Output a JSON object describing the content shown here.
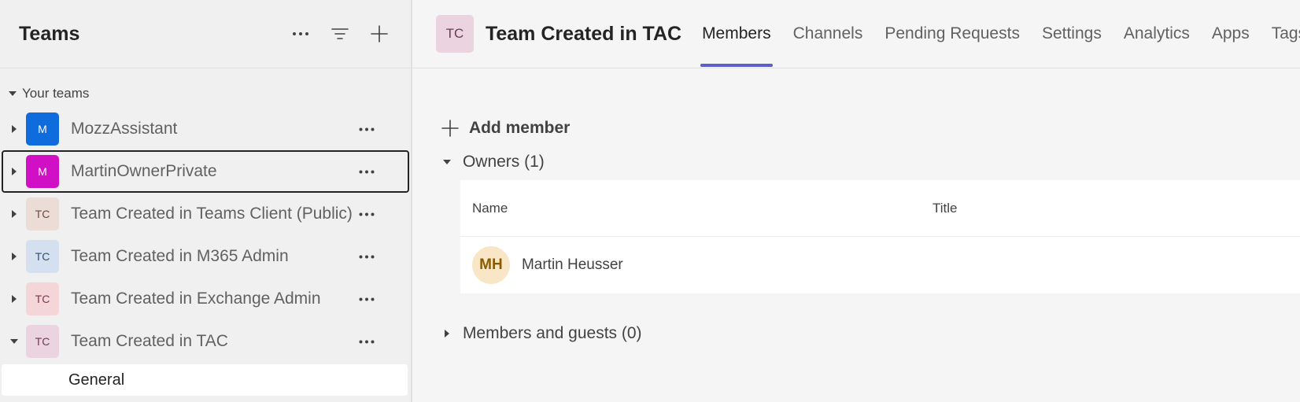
{
  "sidebar": {
    "title": "Teams",
    "actions": {
      "more_icon": "more-horizontal-icon",
      "filter_icon": "filter-icon",
      "add_icon": "plus-icon"
    },
    "section_label": "Your teams",
    "teams": [
      {
        "initials": "M",
        "name": "MozzAssistant",
        "bg": "#0f6cdc",
        "fg": "#ffffff"
      },
      {
        "initials": "M",
        "name": "MartinOwnerPrivate",
        "bg": "#d10fc4",
        "fg": "#ffffff"
      },
      {
        "initials": "TC",
        "name": "Team Created in Teams Client (Public)",
        "bg": "#ecdcd6",
        "fg": "#6b4a40"
      },
      {
        "initials": "TC",
        "name": "Team Created in M365 Admin",
        "bg": "#d4e0ef",
        "fg": "#374d6b"
      },
      {
        "initials": "TC",
        "name": "Team Created in Exchange Admin",
        "bg": "#f5d6d8",
        "fg": "#7a3a40"
      },
      {
        "initials": "TC",
        "name": "Team Created in TAC",
        "bg": "#ecd3e0",
        "fg": "#6b3b56"
      }
    ],
    "channel": "General"
  },
  "header": {
    "avatar": "TC",
    "title": "Team Created in TAC",
    "tabs": [
      "Members",
      "Channels",
      "Pending Requests",
      "Settings",
      "Analytics",
      "Apps",
      "Tags"
    ]
  },
  "members": {
    "add_label": "Add member",
    "owners_label": "Owners (1)",
    "columns": {
      "name": "Name",
      "title": "Title"
    },
    "owners": [
      {
        "initials": "MH",
        "name": "Martin Heusser",
        "title": ""
      }
    ],
    "guests_label": "Members and guests (0)"
  }
}
